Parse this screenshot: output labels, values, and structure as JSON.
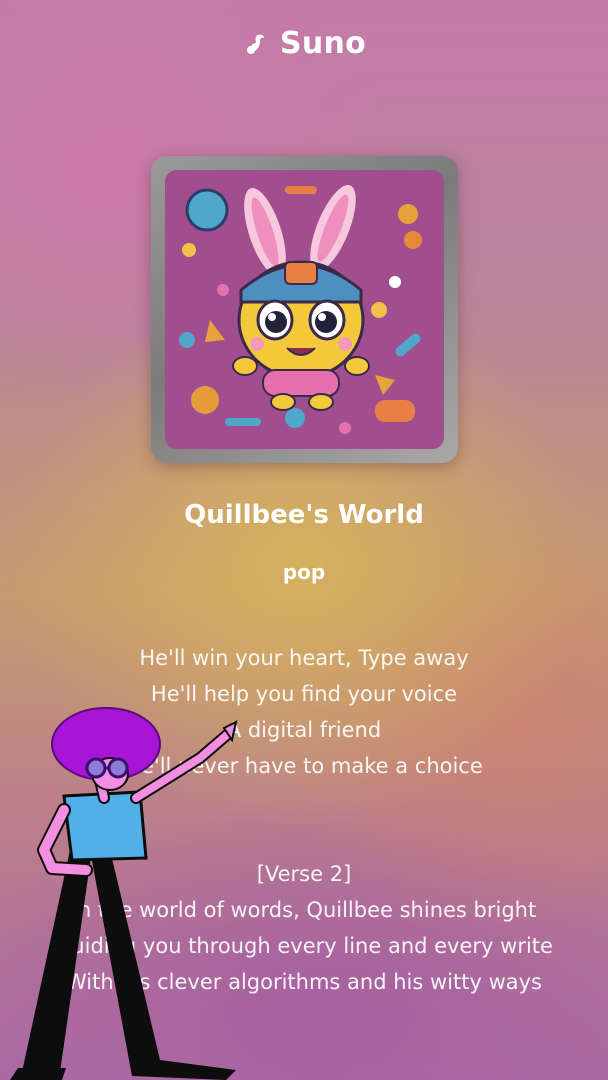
{
  "app": {
    "brand": "Suno"
  },
  "song": {
    "title": "Quillbee's World",
    "genre": "pop"
  },
  "lyrics": {
    "block1": [
      "He'll win your heart, Type away",
      "He'll help you find your voice",
      "A digital friend",
      "He'll never have to make a choice"
    ],
    "block2": [
      "[Verse 2]",
      "In the world of words, Quillbee shines bright",
      "Guiding you through every line and every write",
      "With his clever algorithms and his witty ways"
    ]
  },
  "colors": {
    "text": "#ffffff",
    "frame": "#8c8c8c",
    "art_bg": "#a14e8f"
  }
}
